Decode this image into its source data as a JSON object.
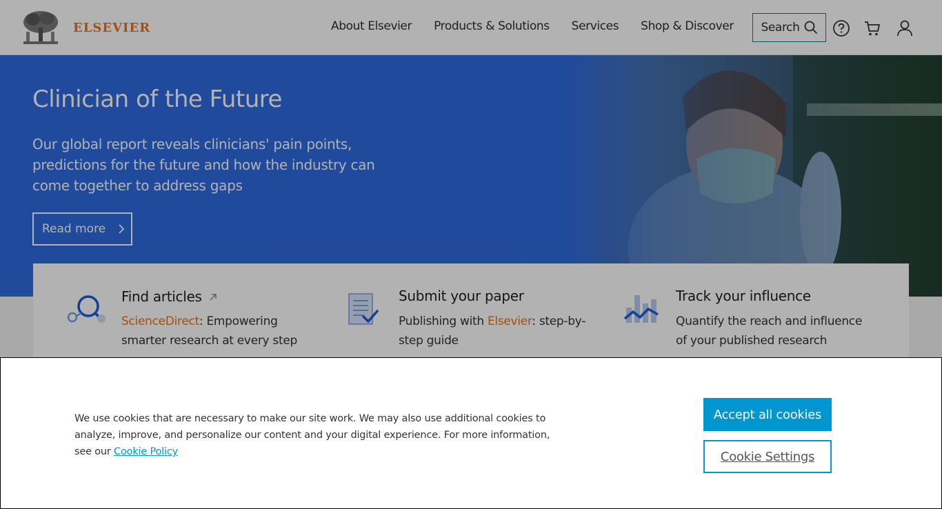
{
  "brand": {
    "name": "ELSEVIER",
    "color": "#e9711c"
  },
  "nav": {
    "items": [
      "About Elsevier",
      "Products & Solutions",
      "Services",
      "Shop & Discover"
    ],
    "search_label": "Search",
    "icons": [
      "search-icon",
      "help-icon",
      "cart-icon",
      "user-icon"
    ]
  },
  "hero": {
    "title": "Clinician of the Future",
    "subtitle": "Our global report reveals clinicians' pain points, predictions for the future and how the industry can come together to address gaps",
    "cta_label": "Read more",
    "background": "#2f6ae0"
  },
  "cards": [
    {
      "title": "Find articles",
      "text_highlight": "ScienceDirect",
      "text_rest": ": Empowering smarter research at every step",
      "icon": "magnifier-icon"
    },
    {
      "title": "Submit your paper",
      "text_prefix": "Publishing with ",
      "text_highlight": "Elsevier",
      "text_rest": ": step-by-step guide",
      "icon": "document-check-icon"
    },
    {
      "title": "Track your influence",
      "text": "Quantify the reach and influence of your published research",
      "icon": "chart-icon"
    }
  ],
  "cookie": {
    "message": "We use cookies that are necessary to make our site work. We may also use additional cookies to analyze, improve, and personalize our content and your digital experience. For more information, see our ",
    "link_label": "Cookie Policy",
    "accept_label": "Accept all cookies",
    "settings_label": "Cookie Settings",
    "accent": "#0096cf"
  }
}
